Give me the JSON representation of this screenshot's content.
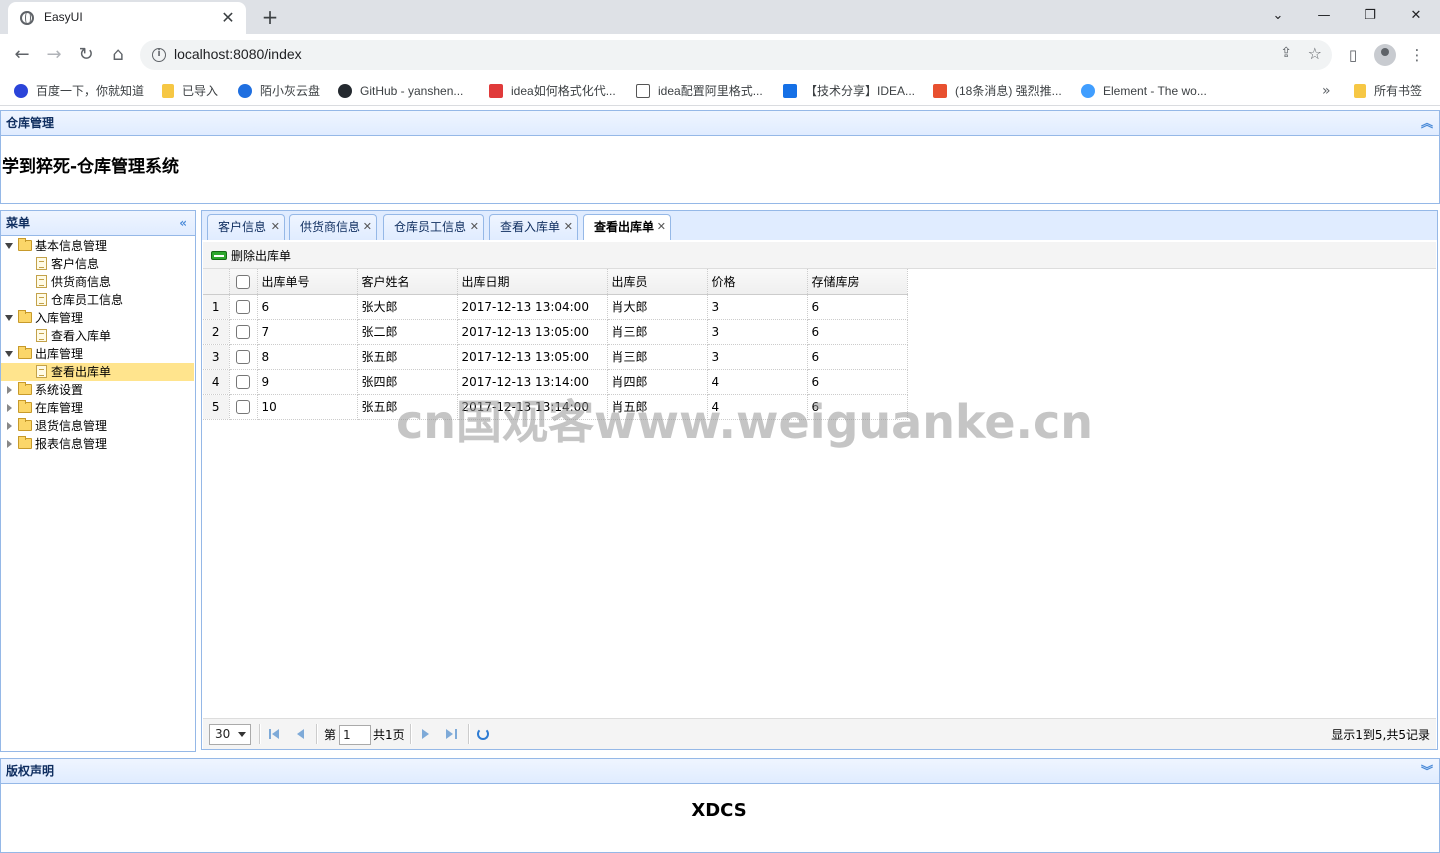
{
  "browser": {
    "tab_title": "EasyUI",
    "url": "localhost:8080/index",
    "bookmarks": [
      {
        "label": "百度一下，你就知道",
        "color": "#2b44d9"
      },
      {
        "label": "已导入",
        "color": "#f6c744"
      },
      {
        "label": "陌小灰云盘",
        "color": "#1f6fe0"
      },
      {
        "label": "GitHub - yanshen...",
        "color": "#24292f"
      },
      {
        "label": "idea如何格式化代...",
        "color": "#e03a3a"
      },
      {
        "label": "idea配置阿里格式...",
        "color": "#555555"
      },
      {
        "label": "【技术分享】IDEA...",
        "color": "#1570e6"
      },
      {
        "label": "(18条消息) 强烈推...",
        "color": "#e8502f"
      },
      {
        "label": "Element - The wo...",
        "color": "#409eff"
      }
    ],
    "bookmarks_more": "»",
    "all_bookmarks": "所有书签"
  },
  "north": {
    "header": "仓库管理",
    "title": "学到猝死-仓库管理系统"
  },
  "west": {
    "header": "菜单",
    "tree": [
      {
        "label": "基本信息管理",
        "level": 0,
        "type": "folder",
        "state": "open"
      },
      {
        "label": "客户信息",
        "level": 1,
        "type": "file"
      },
      {
        "label": "供货商信息",
        "level": 1,
        "type": "file"
      },
      {
        "label": "仓库员工信息",
        "level": 1,
        "type": "file"
      },
      {
        "label": "入库管理",
        "level": 0,
        "type": "folder",
        "state": "open"
      },
      {
        "label": "查看入库单",
        "level": 1,
        "type": "file"
      },
      {
        "label": "出库管理",
        "level": 0,
        "type": "folder",
        "state": "open"
      },
      {
        "label": "查看出库单",
        "level": 1,
        "type": "file",
        "selected": true
      },
      {
        "label": "系统设置",
        "level": 0,
        "type": "folder",
        "state": "closed"
      },
      {
        "label": "在库管理",
        "level": 0,
        "type": "folder",
        "state": "closed"
      },
      {
        "label": "退货信息管理",
        "level": 0,
        "type": "folder",
        "state": "closed"
      },
      {
        "label": "报表信息管理",
        "level": 0,
        "type": "folder",
        "state": "closed"
      }
    ]
  },
  "tabs": [
    {
      "label": "客户信息",
      "active": false
    },
    {
      "label": "供货商信息",
      "active": false
    },
    {
      "label": "仓库员工信息",
      "active": false
    },
    {
      "label": "查看入库单",
      "active": false
    },
    {
      "label": "查看出库单",
      "active": true
    }
  ],
  "toolbar": {
    "delete_label": "删除出库单"
  },
  "grid": {
    "columns": [
      "出库单号",
      "客户姓名",
      "出库日期",
      "出库员",
      "价格",
      "存储库房"
    ],
    "rows": [
      [
        "1",
        "6",
        "张大郎",
        "2017-12-13 13:04:00",
        "肖大郎",
        "3",
        "6"
      ],
      [
        "2",
        "7",
        "张二郎",
        "2017-12-13 13:05:00",
        "肖三郎",
        "3",
        "6"
      ],
      [
        "3",
        "8",
        "张五郎",
        "2017-12-13 13:05:00",
        "肖三郎",
        "3",
        "6"
      ],
      [
        "4",
        "9",
        "张四郎",
        "2017-12-13 13:14:00",
        "肖四郎",
        "4",
        "6"
      ],
      [
        "5",
        "10",
        "张五郎",
        "2017-12-13 13:14:00",
        "肖五郎",
        "4",
        "6"
      ]
    ]
  },
  "pager": {
    "page_size": "30",
    "page_prefix": "第",
    "page_value": "1",
    "page_total": "共1页",
    "info": "显示1到5,共5记录"
  },
  "south": {
    "header": "版权声明",
    "text": "XDCS"
  },
  "watermark": "cn国观客www.weiguanke.cn"
}
